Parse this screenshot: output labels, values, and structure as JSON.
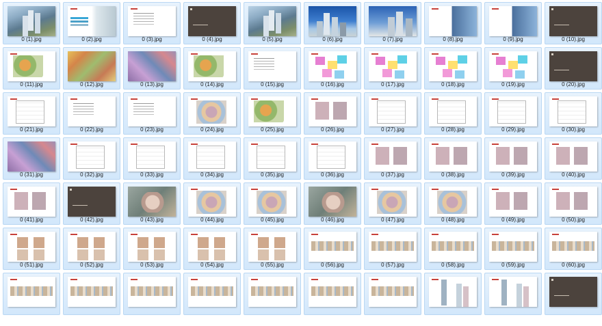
{
  "files": [
    {
      "name": "0 (1).jpg",
      "thumb": "aerial"
    },
    {
      "name": "0 (2).jpg",
      "thumb": "cover"
    },
    {
      "name": "0 (3).jpg",
      "thumb": "text"
    },
    {
      "name": "0 (4).jpg",
      "thumb": "dark"
    },
    {
      "name": "0 (5).jpg",
      "thumb": "aerial"
    },
    {
      "name": "0 (6).jpg",
      "thumb": "sky"
    },
    {
      "name": "0 (7).jpg",
      "thumb": "sky2"
    },
    {
      "name": "0 (8).jpg",
      "thumb": "half"
    },
    {
      "name": "0 (9).jpg",
      "thumb": "half"
    },
    {
      "name": "0 (10).jpg",
      "thumb": "dark"
    },
    {
      "name": "0 (11).jpg",
      "thumb": "mapsmall"
    },
    {
      "name": "0 (12).jpg",
      "thumb": "map"
    },
    {
      "name": "0 (13).jpg",
      "thumb": "map2"
    },
    {
      "name": "0 (14).jpg",
      "thumb": "mapsmall"
    },
    {
      "name": "0 (15).jpg",
      "thumb": "text"
    },
    {
      "name": "0 (16).jpg",
      "thumb": "pastel"
    },
    {
      "name": "0 (17).jpg",
      "thumb": "pastel"
    },
    {
      "name": "0 (18).jpg",
      "thumb": "pastel"
    },
    {
      "name": "0 (19).jpg",
      "thumb": "pastel"
    },
    {
      "name": "0 (20).jpg",
      "thumb": "dark"
    },
    {
      "name": "0 (21).jpg",
      "thumb": "plan"
    },
    {
      "name": "0 (22).jpg",
      "thumb": "text"
    },
    {
      "name": "0 (23).jpg",
      "thumb": "text"
    },
    {
      "name": "0 (24).jpg",
      "thumb": "colorplan"
    },
    {
      "name": "0 (25).jpg",
      "thumb": "mapsmall"
    },
    {
      "name": "0 (26).jpg",
      "thumb": "plan2"
    },
    {
      "name": "0 (27).jpg",
      "thumb": "plan"
    },
    {
      "name": "0 (28).jpg",
      "thumb": "plan"
    },
    {
      "name": "0 (29).jpg",
      "thumb": "plan"
    },
    {
      "name": "0 (30).jpg",
      "thumb": "plan"
    },
    {
      "name": "0 (31).jpg",
      "thumb": "map2"
    },
    {
      "name": "0 (32).jpg",
      "thumb": "plan"
    },
    {
      "name": "0 (33).jpg",
      "thumb": "plan"
    },
    {
      "name": "0 (34).jpg",
      "thumb": "plan"
    },
    {
      "name": "0 (35).jpg",
      "thumb": "plan"
    },
    {
      "name": "0 (36).jpg",
      "thumb": "plan"
    },
    {
      "name": "0 (37).jpg",
      "thumb": "plan2"
    },
    {
      "name": "0 (38).jpg",
      "thumb": "plan2"
    },
    {
      "name": "0 (39).jpg",
      "thumb": "plan2"
    },
    {
      "name": "0 (40).jpg",
      "thumb": "plan2"
    },
    {
      "name": "0 (41).jpg",
      "thumb": "plan2"
    },
    {
      "name": "0 (42).jpg",
      "thumb": "dark"
    },
    {
      "name": "0 (43).jpg",
      "thumb": "site"
    },
    {
      "name": "0 (44).jpg",
      "thumb": "colorplan"
    },
    {
      "name": "0 (45).jpg",
      "thumb": "colorplan"
    },
    {
      "name": "0 (46).jpg",
      "thumb": "site"
    },
    {
      "name": "0 (47).jpg",
      "thumb": "colorplan"
    },
    {
      "name": "0 (48).jpg",
      "thumb": "colorplan"
    },
    {
      "name": "0 (49).jpg",
      "thumb": "plan2"
    },
    {
      "name": "0 (50).jpg",
      "thumb": "plan2"
    },
    {
      "name": "0 (51).jpg",
      "thumb": "floor"
    },
    {
      "name": "0 (52).jpg",
      "thumb": "floor"
    },
    {
      "name": "0 (53).jpg",
      "thumb": "floor"
    },
    {
      "name": "0 (54).jpg",
      "thumb": "floor"
    },
    {
      "name": "0 (55).jpg",
      "thumb": "floor"
    },
    {
      "name": "0 (56).jpg",
      "thumb": "unit"
    },
    {
      "name": "0 (57).jpg",
      "thumb": "unit"
    },
    {
      "name": "0 (58).jpg",
      "thumb": "unit"
    },
    {
      "name": "0 (59).jpg",
      "thumb": "unit"
    },
    {
      "name": "0 (60).jpg",
      "thumb": "unit"
    },
    {
      "name": "",
      "thumb": "unit"
    },
    {
      "name": "",
      "thumb": "unit"
    },
    {
      "name": "",
      "thumb": "unit"
    },
    {
      "name": "",
      "thumb": "unit"
    },
    {
      "name": "",
      "thumb": "unit"
    },
    {
      "name": "",
      "thumb": "unit"
    },
    {
      "name": "",
      "thumb": "unit"
    },
    {
      "name": "",
      "thumb": "elev"
    },
    {
      "name": "",
      "thumb": "elev"
    },
    {
      "name": "",
      "thumb": "dark"
    }
  ]
}
